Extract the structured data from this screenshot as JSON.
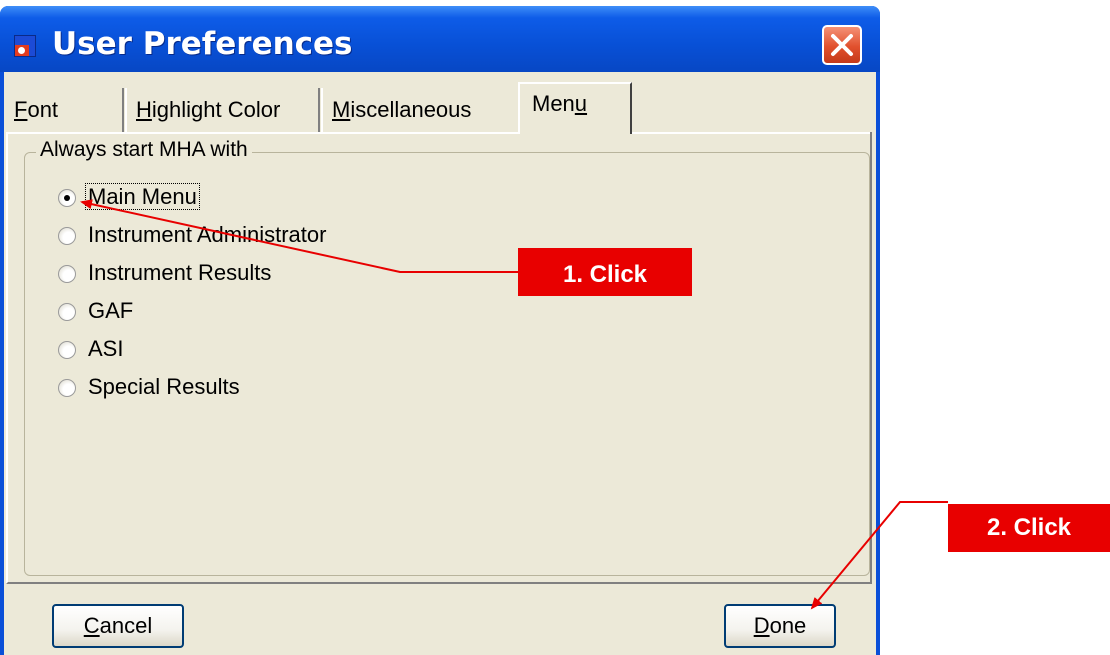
{
  "window": {
    "title": "User Preferences"
  },
  "tabs": [
    {
      "pre": "",
      "accel": "F",
      "post": "ont"
    },
    {
      "pre": "",
      "accel": "H",
      "post": "ighlight Color"
    },
    {
      "pre": "",
      "accel": "M",
      "post": "iscellaneous"
    },
    {
      "pre": "Men",
      "accel": "u",
      "post": ""
    }
  ],
  "active_tab": "Menu",
  "group": {
    "label": "Always start MHA with",
    "options": [
      {
        "label": "Main Menu",
        "selected": true
      },
      {
        "label": "Instrument Administrator",
        "selected": false
      },
      {
        "label": "Instrument Results",
        "selected": false
      },
      {
        "label": "GAF",
        "selected": false
      },
      {
        "label": "ASI",
        "selected": false
      },
      {
        "label": "Special Results",
        "selected": false
      }
    ]
  },
  "buttons": {
    "cancel": {
      "accel": "C",
      "rest": "ancel"
    },
    "done": {
      "accel": "D",
      "rest": "one"
    }
  },
  "annotations": {
    "step1": "1. Click",
    "step2": "2. Click",
    "color": "#e80000"
  }
}
